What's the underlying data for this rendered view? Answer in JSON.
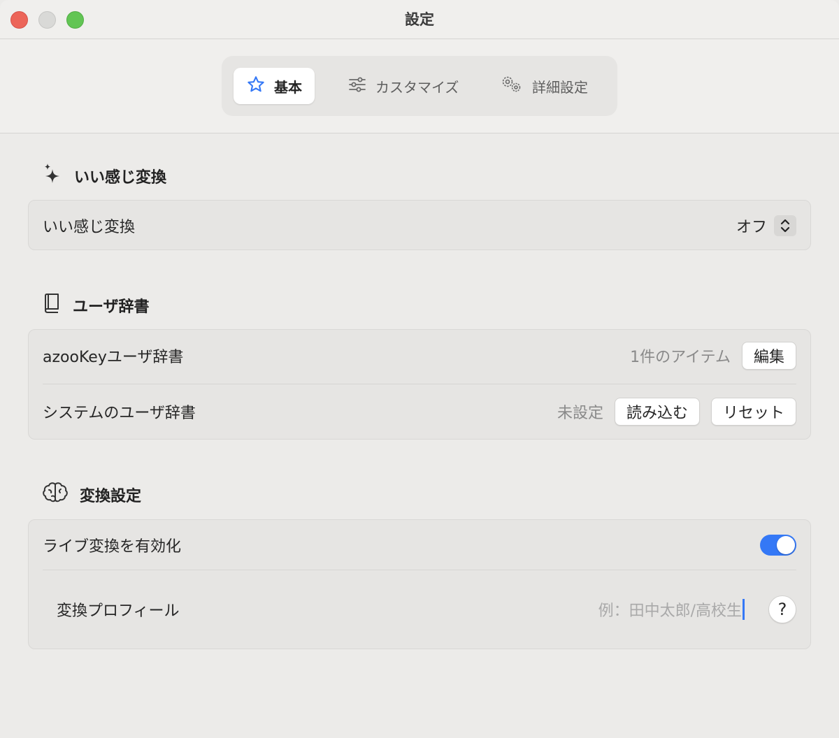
{
  "window": {
    "title": "設定"
  },
  "tabs": [
    {
      "label": "基本",
      "icon": "star-icon",
      "active": true
    },
    {
      "label": "カスタマイズ",
      "icon": "sliders-icon",
      "active": false
    },
    {
      "label": "詳細設定",
      "icon": "gears-icon",
      "active": false
    }
  ],
  "sections": {
    "smart": {
      "title": "いい感じ変換",
      "icon": "sparkles-icon",
      "row_label": "いい感じ変換",
      "value": "オフ"
    },
    "dict": {
      "title": "ユーザ辞書",
      "icon": "book-icon",
      "azookey_label": "azooKeyユーザ辞書",
      "azookey_count": "1件のアイテム",
      "edit_label": "編集",
      "system_label": "システムのユーザ辞書",
      "system_status": "未設定",
      "load_label": "読み込む",
      "reset_label": "リセット"
    },
    "conversion": {
      "title": "変換設定",
      "icon": "brain-icon",
      "live_label": "ライブ変換を有効化",
      "live_enabled": true,
      "profile_label": "変換プロフィール",
      "profile_placeholder": "例：田中太郎/高校生",
      "help_label": "?"
    }
  },
  "colors": {
    "accent": "#3478f6",
    "close": "#ec6559",
    "maximize": "#62c554"
  }
}
